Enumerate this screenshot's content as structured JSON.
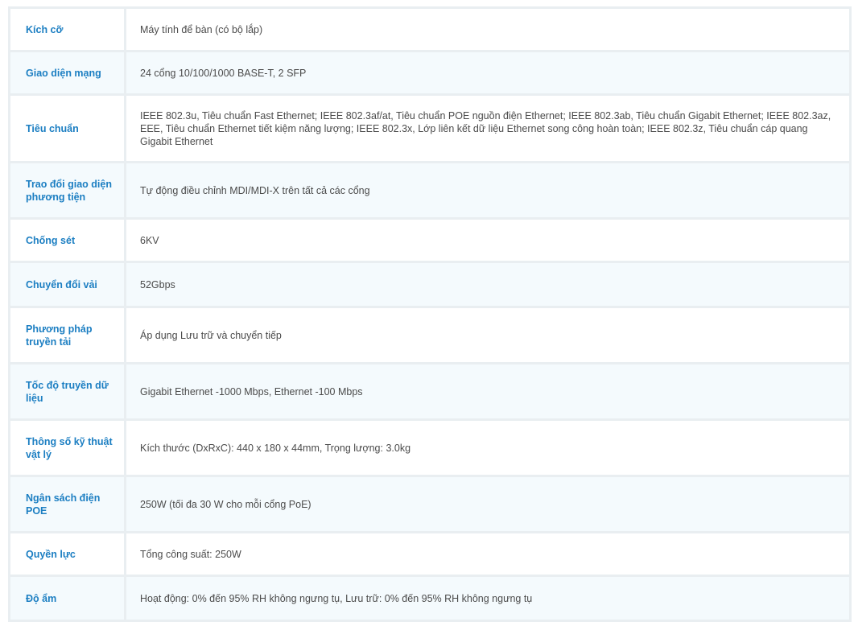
{
  "spec_table": {
    "rows": [
      {
        "label": "Kích cỡ",
        "value": "Máy tính để bàn (có bộ lắp)",
        "height": 54
      },
      {
        "label": "Giao diện mạng",
        "value": "24 cổng 10/100/1000 BASE-T, 2 SFP",
        "height": 54
      },
      {
        "label": "Tiêu chuẩn",
        "value": "IEEE 802.3u, Tiêu chuẩn Fast Ethernet; IEEE 802.3af/at, Tiêu chuẩn POE nguồn điện Ethernet; IEEE 802.3ab, Tiêu chuẩn Gigabit Ethernet; IEEE 802.3az, EEE, Tiêu chuẩn Ethernet tiết kiệm năng lượng; IEEE 802.3x, Lớp liên kết dữ liệu Ethernet song công hoàn toàn; IEEE 802.3z, Tiêu chuẩn cáp quang Gigabit Ethernet",
        "height": 84
      },
      {
        "label": "Trao đổi giao diện phương tiện",
        "value": "Tự động điều chỉnh MDI/MDI-X trên tất cả các cổng",
        "height": 70
      },
      {
        "label": "Chống sét",
        "value": "6KV",
        "height": 54
      },
      {
        "label": "Chuyển đổi vải",
        "value": "52Gbps",
        "height": 56
      },
      {
        "label": "Phương pháp truyền tải",
        "value": "Áp dụng Lưu trữ và chuyển tiếp",
        "height": 70
      },
      {
        "label": "Tốc độ truyền dữ liệu",
        "value": "Gigabit Ethernet -1000 Mbps, Ethernet -100 Mbps",
        "height": 70
      },
      {
        "label": "Thông số kỹ thuật vật lý",
        "value": "Kích thước (DxRxC): 440 x 180 x 44mm, Trọng lượng: 3.0kg",
        "height": 70
      },
      {
        "label": "Ngân sách điện POE",
        "value": "250W (tối đa 30 W cho mỗi cổng PoE)",
        "height": 70
      },
      {
        "label": "Quyền lực",
        "value": "Tổng công suất: 250W",
        "height": 54
      },
      {
        "label": "Độ ẩm",
        "value": "Hoạt động: 0% đến 95% RH không ngưng tụ, Lưu trữ: 0% đến 95% RH không ngưng tụ",
        "height": 56
      }
    ]
  }
}
